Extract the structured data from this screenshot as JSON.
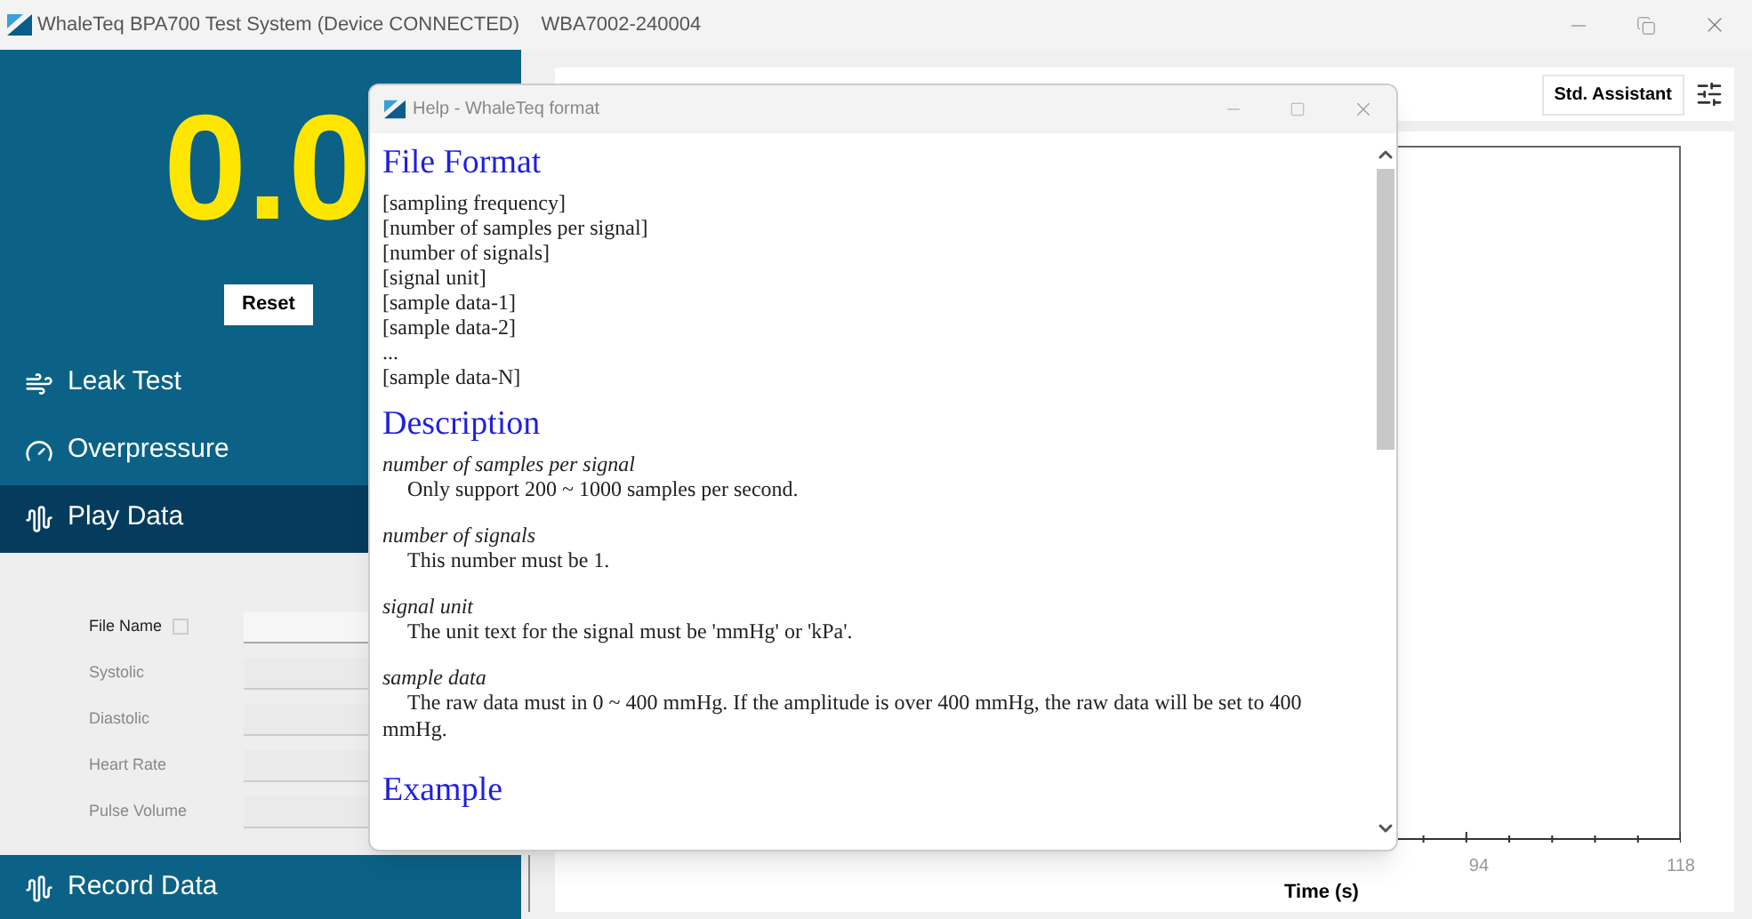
{
  "window": {
    "title": "WhaleTeq BPA700 Test System (Device CONNECTED)    WBA7002-240004"
  },
  "display": {
    "value": "0.0",
    "reset_button": "Reset"
  },
  "nav": [
    {
      "label": "Leak Test",
      "kind": "leak",
      "selected": false
    },
    {
      "label": "Overpressure",
      "kind": "gauge",
      "selected": false
    },
    {
      "label": "Play Data",
      "kind": "wave",
      "selected": true
    },
    {
      "label": "Record Data",
      "kind": "wave",
      "selected": false
    }
  ],
  "play_data_form": {
    "fields": [
      {
        "label": "File Name",
        "disabled": false,
        "help": true
      },
      {
        "label": "Systolic",
        "disabled": true,
        "help": false
      },
      {
        "label": "Diastolic",
        "disabled": true,
        "help": false
      },
      {
        "label": "Heart Rate",
        "disabled": true,
        "help": false
      },
      {
        "label": "Pulse Volume",
        "disabled": true,
        "help": false
      }
    ]
  },
  "main": {
    "assistant_button": "Std. Assistant",
    "x_axis": {
      "label": "Time (s)",
      "tick_labels": [
        "94",
        "118"
      ]
    }
  },
  "help_dialog": {
    "title": "Help - WhaleTeq format",
    "sections": [
      {
        "kind": "heading",
        "text": "File Format"
      },
      {
        "kind": "lines",
        "lines": [
          "[sampling frequency]",
          "[number of samples per signal]",
          "[number of signals]",
          "[signal unit]",
          "[sample data-1]",
          "[sample data-2]",
          "...",
          "[sample data-N]"
        ]
      },
      {
        "kind": "heading",
        "text": "Description"
      },
      {
        "kind": "term",
        "term": "number of samples per signal",
        "definition": "Only support 200 ~ 1000 samples per second."
      },
      {
        "kind": "term",
        "term": "number of signals",
        "definition": "This number must be 1."
      },
      {
        "kind": "term",
        "term": "signal unit",
        "definition": "The unit text for the signal must be 'mmHg' or 'kPa'."
      },
      {
        "kind": "term",
        "term": "sample data",
        "definition": "The raw data must in 0 ~ 400 mmHg. If the amplitude is over 400 mmHg, the raw data will be set to 400 mmHg."
      },
      {
        "kind": "heading",
        "text": "Example"
      }
    ]
  }
}
